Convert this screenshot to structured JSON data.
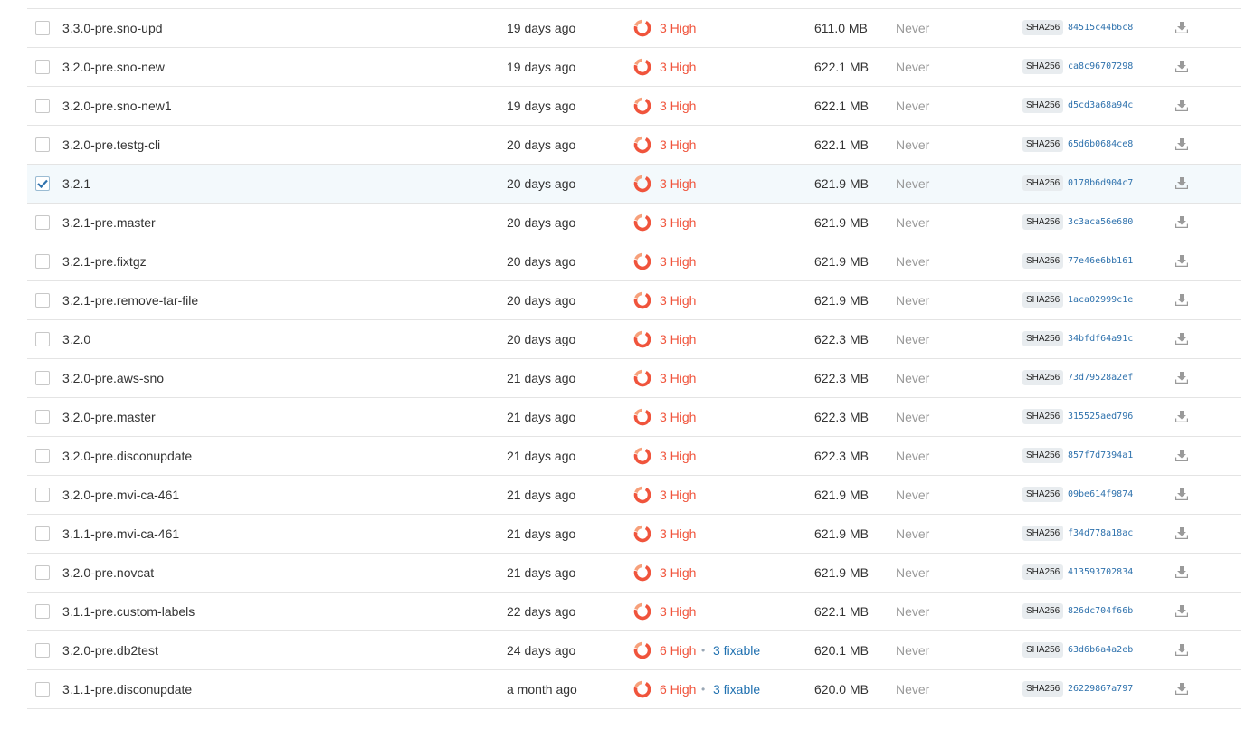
{
  "colors": {
    "high": "#f0543c",
    "fixable": "#1f70b0",
    "digest": "#2f72ad",
    "muted": "#999999",
    "selected_row": "#f3f9fc"
  },
  "rows": [
    {
      "tag": "3.3.0-pre.sno-upd",
      "age": "19 days ago",
      "high": "3 High",
      "fixable": "",
      "size": "611.0 MB",
      "pulled": "Never",
      "sha_label": "SHA256",
      "digest": "84515c44b6c8",
      "checked": false
    },
    {
      "tag": "3.2.0-pre.sno-new",
      "age": "19 days ago",
      "high": "3 High",
      "fixable": "",
      "size": "622.1 MB",
      "pulled": "Never",
      "sha_label": "SHA256",
      "digest": "ca8c96707298",
      "checked": false
    },
    {
      "tag": "3.2.0-pre.sno-new1",
      "age": "19 days ago",
      "high": "3 High",
      "fixable": "",
      "size": "622.1 MB",
      "pulled": "Never",
      "sha_label": "SHA256",
      "digest": "d5cd3a68a94c",
      "checked": false
    },
    {
      "tag": "3.2.0-pre.testg-cli",
      "age": "20 days ago",
      "high": "3 High",
      "fixable": "",
      "size": "622.1 MB",
      "pulled": "Never",
      "sha_label": "SHA256",
      "digest": "65d6b0684ce8",
      "checked": false
    },
    {
      "tag": "3.2.1",
      "age": "20 days ago",
      "high": "3 High",
      "fixable": "",
      "size": "621.9 MB",
      "pulled": "Never",
      "sha_label": "SHA256",
      "digest": "0178b6d904c7",
      "checked": true
    },
    {
      "tag": "3.2.1-pre.master",
      "age": "20 days ago",
      "high": "3 High",
      "fixable": "",
      "size": "621.9 MB",
      "pulled": "Never",
      "sha_label": "SHA256",
      "digest": "3c3aca56e680",
      "checked": false
    },
    {
      "tag": "3.2.1-pre.fixtgz",
      "age": "20 days ago",
      "high": "3 High",
      "fixable": "",
      "size": "621.9 MB",
      "pulled": "Never",
      "sha_label": "SHA256",
      "digest": "77e46e6bb161",
      "checked": false
    },
    {
      "tag": "3.2.1-pre.remove-tar-file",
      "age": "20 days ago",
      "high": "3 High",
      "fixable": "",
      "size": "621.9 MB",
      "pulled": "Never",
      "sha_label": "SHA256",
      "digest": "1aca02999c1e",
      "checked": false
    },
    {
      "tag": "3.2.0",
      "age": "20 days ago",
      "high": "3 High",
      "fixable": "",
      "size": "622.3 MB",
      "pulled": "Never",
      "sha_label": "SHA256",
      "digest": "34bfdf64a91c",
      "checked": false
    },
    {
      "tag": "3.2.0-pre.aws-sno",
      "age": "21 days ago",
      "high": "3 High",
      "fixable": "",
      "size": "622.3 MB",
      "pulled": "Never",
      "sha_label": "SHA256",
      "digest": "73d79528a2ef",
      "checked": false
    },
    {
      "tag": "3.2.0-pre.master",
      "age": "21 days ago",
      "high": "3 High",
      "fixable": "",
      "size": "622.3 MB",
      "pulled": "Never",
      "sha_label": "SHA256",
      "digest": "315525aed796",
      "checked": false
    },
    {
      "tag": "3.2.0-pre.disconupdate",
      "age": "21 days ago",
      "high": "3 High",
      "fixable": "",
      "size": "622.3 MB",
      "pulled": "Never",
      "sha_label": "SHA256",
      "digest": "857f7d7394a1",
      "checked": false
    },
    {
      "tag": "3.2.0-pre.mvi-ca-461",
      "age": "21 days ago",
      "high": "3 High",
      "fixable": "",
      "size": "621.9 MB",
      "pulled": "Never",
      "sha_label": "SHA256",
      "digest": "09be614f9874",
      "checked": false
    },
    {
      "tag": "3.1.1-pre.mvi-ca-461",
      "age": "21 days ago",
      "high": "3 High",
      "fixable": "",
      "size": "621.9 MB",
      "pulled": "Never",
      "sha_label": "SHA256",
      "digest": "f34d778a18ac",
      "checked": false
    },
    {
      "tag": "3.2.0-pre.novcat",
      "age": "21 days ago",
      "high": "3 High",
      "fixable": "",
      "size": "621.9 MB",
      "pulled": "Never",
      "sha_label": "SHA256",
      "digest": "413593702834",
      "checked": false
    },
    {
      "tag": "3.1.1-pre.custom-labels",
      "age": "22 days ago",
      "high": "3 High",
      "fixable": "",
      "size": "622.1 MB",
      "pulled": "Never",
      "sha_label": "SHA256",
      "digest": "826dc704f66b",
      "checked": false
    },
    {
      "tag": "3.2.0-pre.db2test",
      "age": "24 days ago",
      "high": "6 High",
      "fixable": "3 fixable",
      "size": "620.1 MB",
      "pulled": "Never",
      "sha_label": "SHA256",
      "digest": "63d6b6a4a2eb",
      "checked": false
    },
    {
      "tag": "3.1.1-pre.disconupdate",
      "age": "a month ago",
      "high": "6 High",
      "fixable": "3 fixable",
      "size": "620.0 MB",
      "pulled": "Never",
      "sha_label": "SHA256",
      "digest": "26229867a797",
      "checked": false
    }
  ]
}
